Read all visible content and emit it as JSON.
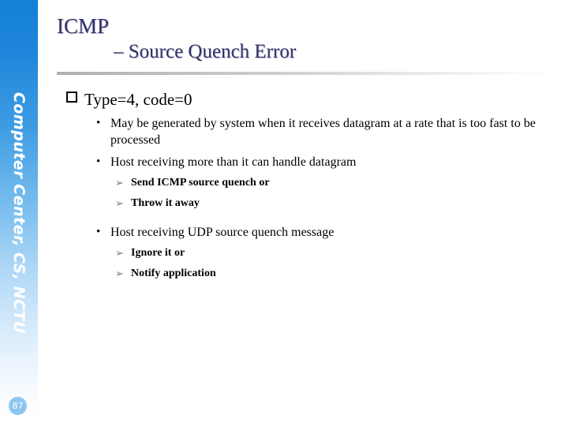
{
  "sidebar": {
    "label": "Computer Center, CS, NCTU",
    "page_number": "87",
    "gradient_top_color": "#1380d6",
    "gradient_bottom_color": "#ffffff",
    "badge_color": "#8cc6f0"
  },
  "title": {
    "line1": "ICMP",
    "line2": "– Source Quench Error",
    "color": "#31316b"
  },
  "content": {
    "heading": {
      "marker": "hollow-square-bullet",
      "text": "Type=4, code=0"
    },
    "bullets": [
      {
        "marker": "round-bullet",
        "text": "May be generated by system when it receives datagram at a rate that is too fast to be processed",
        "subitems": []
      },
      {
        "marker": "round-bullet",
        "text": "Host receiving more than it can handle datagram",
        "subitems": [
          {
            "marker": "arrow-bullet",
            "text": "Send ICMP source quench or"
          },
          {
            "marker": "arrow-bullet",
            "text": "Throw it away"
          }
        ]
      },
      {
        "marker": "round-bullet",
        "text": "Host receiving UDP source quench message",
        "subitems": [
          {
            "marker": "arrow-bullet",
            "text": "Ignore it or"
          },
          {
            "marker": "arrow-bullet",
            "text": "Notify application"
          }
        ]
      }
    ]
  },
  "glyphs": {
    "round_bullet": "•",
    "arrow_bullet": "➢"
  }
}
